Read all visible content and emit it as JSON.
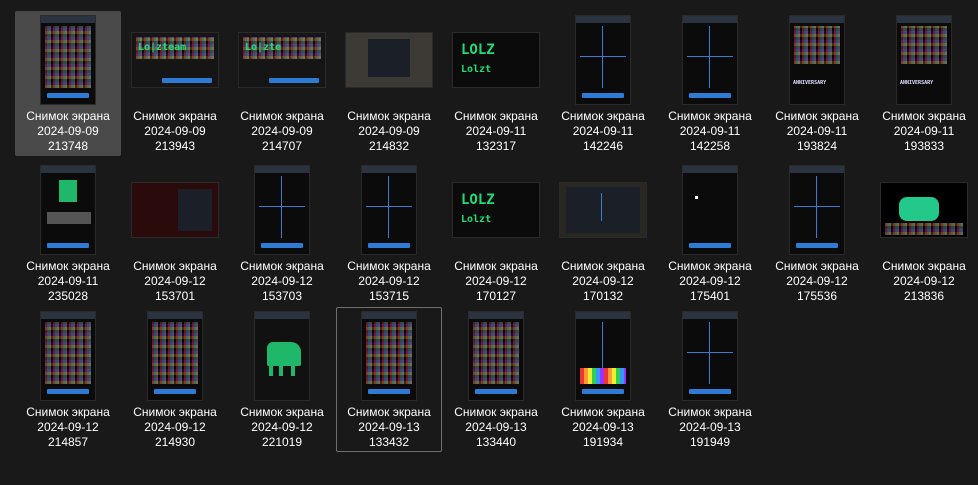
{
  "caption_prefix": "Снимок экрана",
  "items": [
    {
      "date": "2024-09-09",
      "time": "213748"
    },
    {
      "date": "2024-09-09",
      "time": "213943"
    },
    {
      "date": "2024-09-09",
      "time": "214707"
    },
    {
      "date": "2024-09-09",
      "time": "214832"
    },
    {
      "date": "2024-09-11",
      "time": "132317"
    },
    {
      "date": "2024-09-11",
      "time": "142246"
    },
    {
      "date": "2024-09-11",
      "time": "142258"
    },
    {
      "date": "2024-09-11",
      "time": "193824"
    },
    {
      "date": "2024-09-11",
      "time": "193833"
    },
    {
      "date": "2024-09-11",
      "time": "235028"
    },
    {
      "date": "2024-09-12",
      "time": "153701"
    },
    {
      "date": "2024-09-12",
      "time": "153703"
    },
    {
      "date": "2024-09-12",
      "time": "153715"
    },
    {
      "date": "2024-09-12",
      "time": "170127"
    },
    {
      "date": "2024-09-12",
      "time": "170132"
    },
    {
      "date": "2024-09-12",
      "time": "175401"
    },
    {
      "date": "2024-09-12",
      "time": "175536"
    },
    {
      "date": "2024-09-12",
      "time": "213836"
    },
    {
      "date": "2024-09-12",
      "time": "214857"
    },
    {
      "date": "2024-09-12",
      "time": "214930"
    },
    {
      "date": "2024-09-12",
      "time": "221019"
    },
    {
      "date": "2024-09-13",
      "time": "133432"
    },
    {
      "date": "2024-09-13",
      "time": "133440"
    },
    {
      "date": "2024-09-13",
      "time": "191934"
    },
    {
      "date": "2024-09-13",
      "time": "191949"
    }
  ],
  "thumb_text": {
    "lolzteam": "Lo|zteam",
    "lolzteam_short": "Lo|zte",
    "lolz_big": "LOLZ",
    "lolz_small": "Lolzt",
    "anniversary": "ANNIVERSARY"
  },
  "colors": {
    "background": "#191919",
    "selected_tile": "#4a4a4a",
    "focus_border": "#6e6e6e",
    "accent_blue": "#2e7bd6",
    "pixel_green": "#1fb86a"
  }
}
